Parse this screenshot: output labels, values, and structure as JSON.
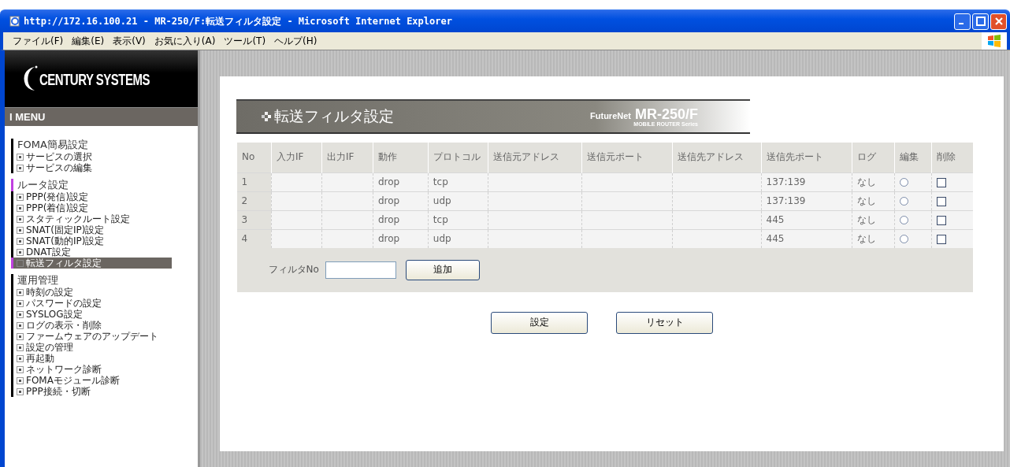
{
  "window": {
    "title": "http://172.16.100.21 - MR-250/F:転送フィルタ設定 - Microsoft Internet Explorer"
  },
  "menu_bar": [
    "ファイル(F)",
    "編集(E)",
    "表示(V)",
    "お気に入り(A)",
    "ツール(T)",
    "ヘルプ(H)"
  ],
  "sidebar": {
    "logo": "CENTURY SYSTEMS",
    "menu_title": "I MENU",
    "sections": [
      {
        "heading": "FOMA簡易設定",
        "items": [
          {
            "label": "サービスの選択",
            "selected": false
          },
          {
            "label": "サービスの編集",
            "selected": false
          }
        ]
      },
      {
        "heading": "ルータ設定",
        "items": [
          {
            "label": "PPP(発信)設定",
            "selected": false
          },
          {
            "label": "PPP(着信)設定",
            "selected": false
          },
          {
            "label": "スタティックルート設定",
            "selected": false
          },
          {
            "label": "SNAT(固定IP)設定",
            "selected": false
          },
          {
            "label": "SNAT(動的IP)設定",
            "selected": false
          },
          {
            "label": "DNAT設定",
            "selected": false
          },
          {
            "label": "転送フィルタ設定",
            "selected": true
          }
        ]
      },
      {
        "heading": "運用管理",
        "items": [
          {
            "label": "時刻の設定",
            "selected": false
          },
          {
            "label": "パスワードの設定",
            "selected": false
          },
          {
            "label": "SYSLOG設定",
            "selected": false
          },
          {
            "label": "ログの表示・削除",
            "selected": false
          },
          {
            "label": "ファームウェアのアップデート",
            "selected": false
          },
          {
            "label": "設定の管理",
            "selected": false
          },
          {
            "label": "再起動",
            "selected": false
          },
          {
            "label": "ネットワーク診断",
            "selected": false
          },
          {
            "label": "FOMAモジュール診断",
            "selected": false
          },
          {
            "label": "PPP接続・切断",
            "selected": false
          }
        ]
      }
    ]
  },
  "banner": {
    "title": "転送フィルタ設定",
    "product_brand": "FutureNet",
    "product_model": "MR-250/F",
    "product_series": "MOBILE ROUTER Series"
  },
  "table": {
    "columns": [
      "No",
      "入力IF",
      "出力IF",
      "動作",
      "プロトコル",
      "送信元アドレス",
      "送信元ポート",
      "送信先アドレス",
      "送信先ポート",
      "ログ",
      "編集",
      "削除"
    ],
    "rows": [
      {
        "no": "1",
        "action": "drop",
        "protocol": "tcp",
        "dst_port": "137:139",
        "log": "なし",
        "edit_selected": false,
        "delete_checked": false
      },
      {
        "no": "2",
        "action": "drop",
        "protocol": "udp",
        "dst_port": "137:139",
        "log": "なし",
        "edit_selected": false,
        "delete_checked": false
      },
      {
        "no": "3",
        "action": "drop",
        "protocol": "tcp",
        "dst_port": "445",
        "log": "なし",
        "edit_selected": false,
        "delete_checked": false
      },
      {
        "no": "4",
        "action": "drop",
        "protocol": "udp",
        "dst_port": "445",
        "log": "なし",
        "edit_selected": false,
        "delete_checked": false
      }
    ]
  },
  "filter_no": {
    "label": "フィルタNo",
    "add_button": "追加"
  },
  "buttons": [
    "設定",
    "リセット"
  ]
}
